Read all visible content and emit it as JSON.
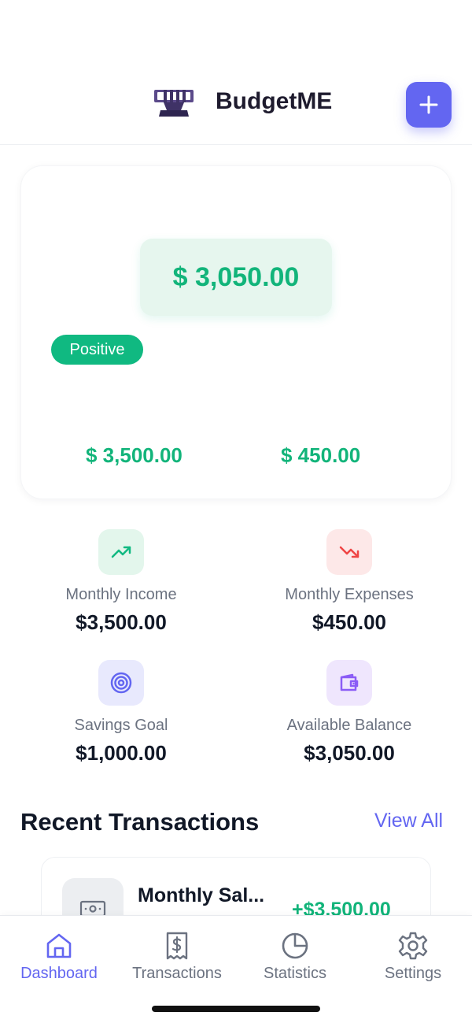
{
  "header": {
    "title": "BudgetME"
  },
  "balance_card": {
    "balance": "$ 3,050.00",
    "status": "Positive",
    "income": "$ 3,500.00",
    "expenses": "$ 450.00"
  },
  "stats": [
    {
      "label": "Monthly Income",
      "value": "$3,500.00",
      "icon": "trending-up-icon"
    },
    {
      "label": "Monthly Expenses",
      "value": "$450.00",
      "icon": "trending-down-icon"
    },
    {
      "label": "Savings Goal",
      "value": "$1,000.00",
      "icon": "target-icon"
    },
    {
      "label": "Available Balance",
      "value": "$3,050.00",
      "icon": "wallet-icon"
    }
  ],
  "recent": {
    "title": "Recent Transactions",
    "view_all": "View All",
    "items": [
      {
        "title": "Monthly Sal...",
        "amount": "+$3,500.00",
        "icon": "cash-icon"
      }
    ]
  },
  "nav": [
    {
      "label": "Dashboard",
      "icon": "home-icon",
      "active": true
    },
    {
      "label": "Transactions",
      "icon": "receipt-icon",
      "active": false
    },
    {
      "label": "Statistics",
      "icon": "pie-chart-icon",
      "active": false
    },
    {
      "label": "Settings",
      "icon": "gear-icon",
      "active": false
    }
  ],
  "colors": {
    "accent": "#6366f1",
    "positive": "#10b981",
    "expense": "#ef4444"
  }
}
